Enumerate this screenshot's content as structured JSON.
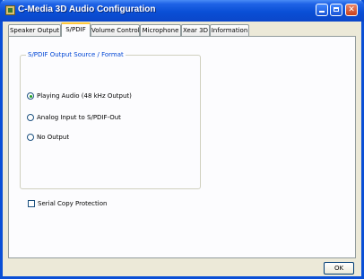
{
  "window": {
    "title": "C-Media 3D Audio Configuration"
  },
  "tabs": [
    {
      "label": "Speaker Output"
    },
    {
      "label": "S/PDIF"
    },
    {
      "label": "Volume Control"
    },
    {
      "label": "Microphone"
    },
    {
      "label": "Xear 3D"
    },
    {
      "label": "Information"
    }
  ],
  "group": {
    "label": "S/PDIF Output Source / Format"
  },
  "radios": [
    {
      "label": "Playing Audio (48  kHz Output)",
      "checked": true
    },
    {
      "label": "Analog  Input to S/PDIF-Out",
      "checked": false
    },
    {
      "label": "No Output",
      "checked": false
    }
  ],
  "checkbox": {
    "label": "Serial Copy Protection",
    "checked": false
  },
  "buttons": {
    "ok": "OK"
  },
  "colors": {
    "titlebar": "#0a4fd6",
    "tab_highlight": "#ffc83c",
    "group_label": "#0046d5"
  }
}
